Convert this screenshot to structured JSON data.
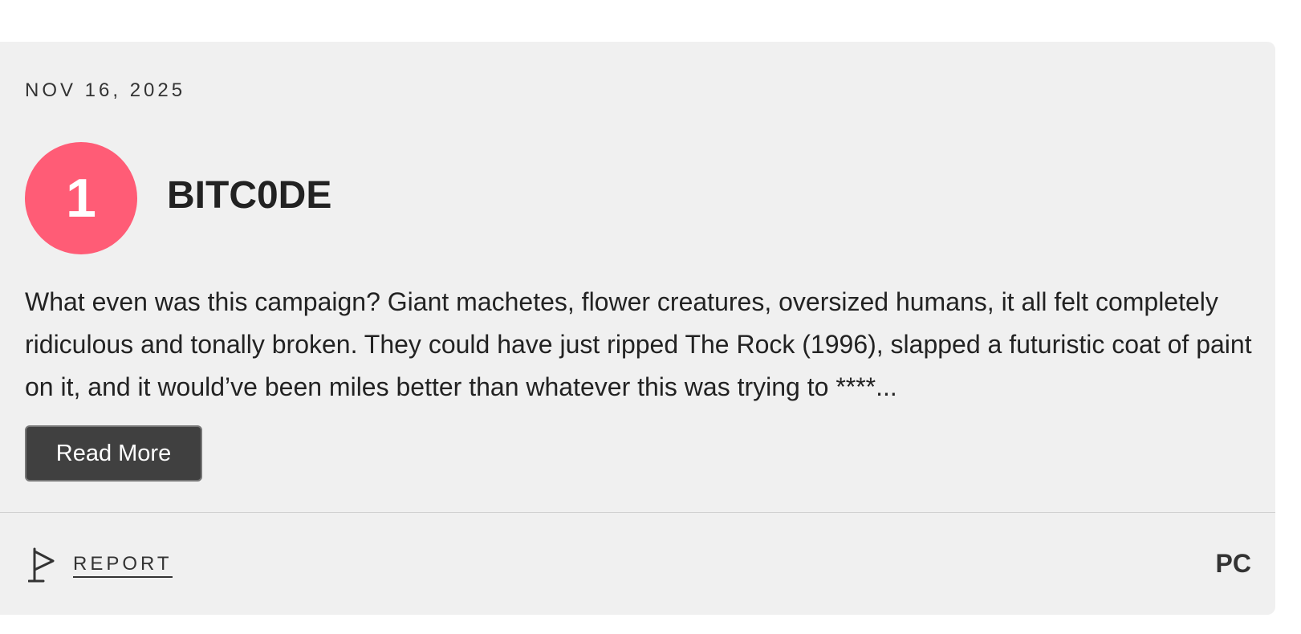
{
  "review": {
    "date": "NOV 16, 2025",
    "score": "1",
    "username": "BITC0DE",
    "body": "What even was this campaign? Giant machetes, flower creatures, oversized humans, it all felt completely ridiculous and tonally broken. They could have just ripped The Rock (1996), slapped a futuristic coat of paint on it, and it would’ve been miles better than whatever this was trying to ****...",
    "read_more_label": "Read More",
    "report_label": "REPORT",
    "platform": "PC",
    "score_color": "#ff5c76",
    "icons": {
      "report": "flag-icon"
    }
  }
}
